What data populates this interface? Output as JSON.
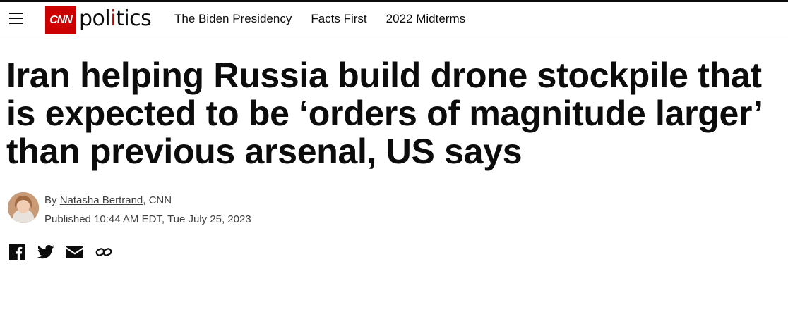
{
  "header": {
    "logo_text": "CNN",
    "section_prefix": "pol",
    "section_accent": "i",
    "section_suffix": "tics",
    "nav": [
      {
        "label": "The Biden Presidency"
      },
      {
        "label": "Facts First"
      },
      {
        "label": "2022 Midterms"
      }
    ],
    "menu_icon": "hamburger-menu-icon",
    "brand_color": "#cc0000"
  },
  "article": {
    "headline": "Iran helping Russia build drone stockpile that is expected to be ‘orders of magnitude larger’ than previous arsenal, US says",
    "byline_prefix": "By ",
    "author": "Natasha Bertrand",
    "byline_suffix": ", CNN",
    "published": "Published 10:44 AM EDT, Tue July 25, 2023"
  },
  "share": {
    "icons": [
      "facebook-icon",
      "twitter-icon",
      "email-icon",
      "link-icon"
    ]
  }
}
